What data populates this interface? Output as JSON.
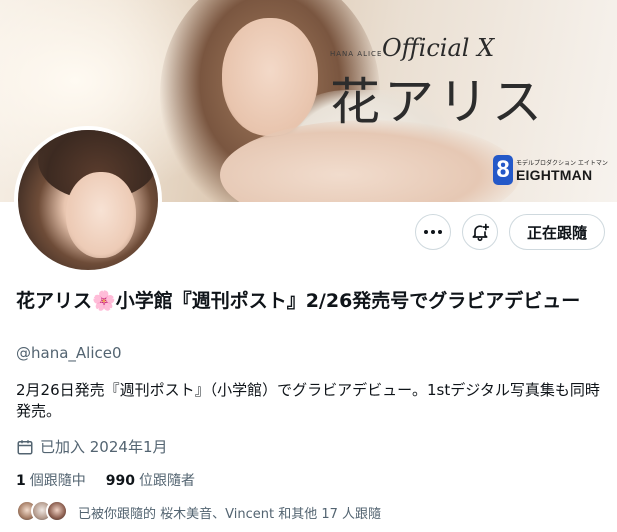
{
  "banner": {
    "small_text": "HANA ALICE",
    "official_text": "Official X",
    "name_text": "花アリス",
    "agency_sub": "モデルプロダクション エイトマン",
    "agency_digit": "8",
    "agency_name": "EIGHTMAN"
  },
  "header_actions": {
    "more_icon": "more-horizontal-icon",
    "notify_icon": "bell-add-icon",
    "follow_label": "正在跟隨"
  },
  "profile": {
    "display_name_part1": "花アリス",
    "name_emoji": "🌸",
    "display_name_part2": "小学館『週刊ポスト』2/26発売号でグラビアデビュー",
    "handle": "@hana_Alice0",
    "bio": "2月26日発売『週刊ポスト』（小学館）でグラビアデビュー。1stデジタル写真集も同時発売。",
    "joined_icon": "calendar-icon",
    "joined": "已加入 2024年1月"
  },
  "stats": {
    "following_count": "1",
    "following_label": "個跟隨中",
    "followers_count": "990",
    "followers_label": "位跟隨者"
  },
  "followed_by": {
    "text": "已被你跟隨的 桜木美音、Vincent 和其他 17 人跟隨"
  },
  "colors": {
    "text_primary": "#0f1419",
    "text_secondary": "#536471",
    "border": "#cfd9de",
    "agency_blue": "#2458c8"
  }
}
